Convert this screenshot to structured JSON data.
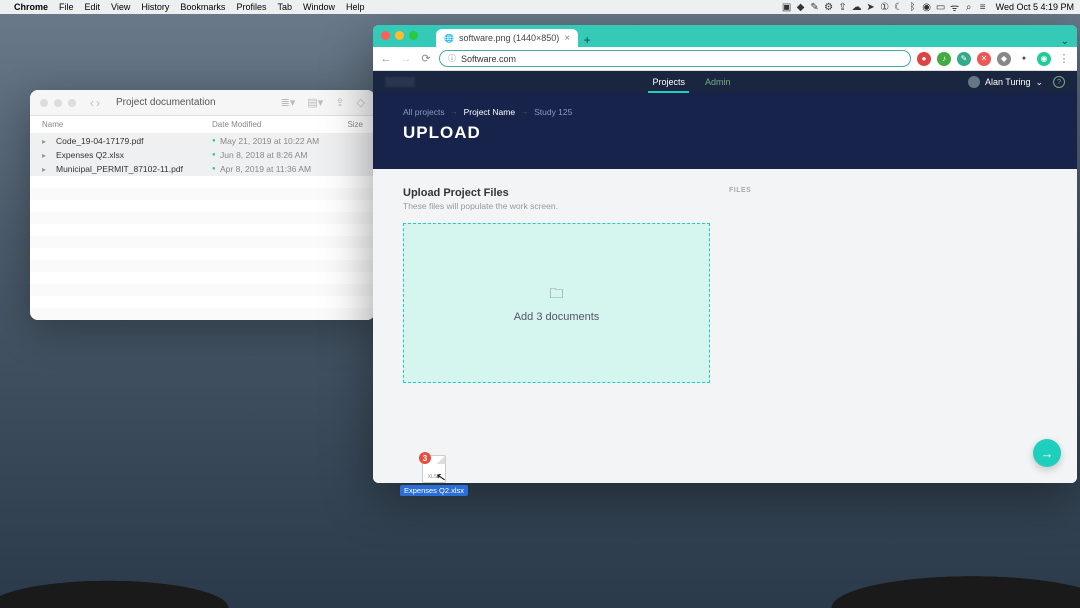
{
  "menubar": {
    "app": "Chrome",
    "items": [
      "File",
      "Edit",
      "View",
      "History",
      "Bookmarks",
      "Profiles",
      "Tab",
      "Window",
      "Help"
    ],
    "clock": "Wed Oct 5  4:19 PM"
  },
  "finder": {
    "title": "Project documentation",
    "cols": {
      "name": "Name",
      "date": "Date Modified",
      "size": "Size"
    },
    "rows": [
      {
        "name": "Code_19-04-17179.pdf",
        "date": "May 21, 2019 at 10:22 AM"
      },
      {
        "name": "Expenses Q2.xlsx",
        "date": "Jun 8, 2018 at 8:26 AM"
      },
      {
        "name": "Municipal_PERMIT_87102-11.pdf",
        "date": "Apr 8, 2019 at 11:36 AM"
      }
    ]
  },
  "chrome": {
    "tab_title": "software.png (1440×850)",
    "url": "Software.com"
  },
  "app": {
    "nav": {
      "projects": "Projects",
      "admin": "Admin",
      "user": "Alan Turing"
    },
    "crumbs": {
      "a": "All projects",
      "b": "Project Name",
      "c": "Study 125"
    },
    "hero": "UPLOAD",
    "section": {
      "title": "Upload Project Files",
      "sub": "These files will populate the work screen."
    },
    "files_label": "FILES",
    "dropzone": "Add 3 documents"
  },
  "drag": {
    "badge": "3",
    "label": "Expenses Q2.xlsx",
    "ext": "XLSX"
  }
}
